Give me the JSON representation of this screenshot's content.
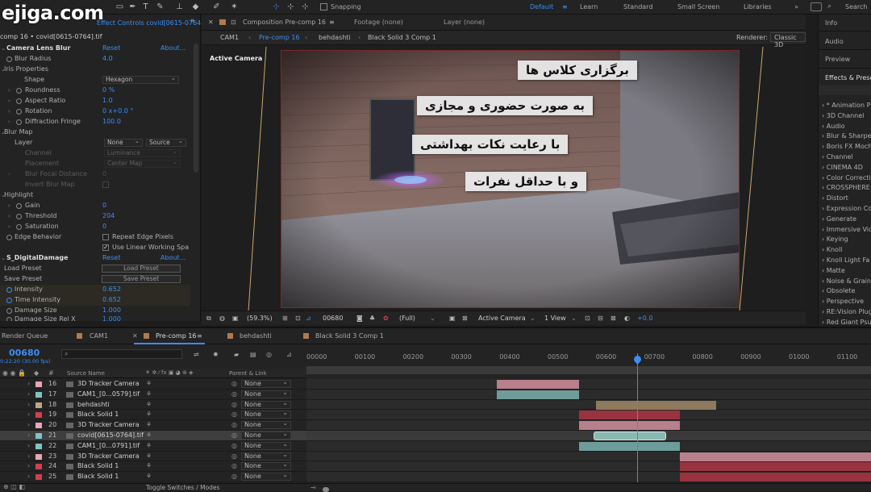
{
  "watermark": "ejiga.com",
  "toolbar": {
    "snapping_label": "Snapping",
    "workspaces": [
      "Default",
      "Learn",
      "Standard",
      "Small Screen",
      "Libraries"
    ],
    "active_workspace": "Default",
    "search_label": "Search"
  },
  "effects_panel": {
    "header": "Effect Controls covid[0615-0764].tif",
    "subtitle": "comp 16 • covid[0615-0764].tif",
    "reset": "Reset",
    "about": "About...",
    "rows": {
      "camera_lens_blur": "Camera Lens Blur",
      "blur_radius": "Blur Radius",
      "blur_radius_val": "4.0",
      "iris_properties": "Iris Properties",
      "shape": "Shape",
      "shape_val": "Hexagon",
      "roundness": "Roundness",
      "roundness_val": "0 %",
      "aspect_ratio": "Aspect Ratio",
      "aspect_ratio_val": "1.0",
      "rotation": "Rotation",
      "rotation_val": "0 x+0.0 °",
      "diffraction_fringe": "Diffraction Fringe",
      "diffraction_fringe_val": "100.0",
      "blur_map": "Blur Map",
      "layer": "Layer",
      "layer_val": "None",
      "layer_source": "Source",
      "channel": "Channel",
      "channel_val": "Luminance",
      "placement": "Placement",
      "placement_val": "Center Map",
      "blur_focal_distance": "Blur Focal Distance",
      "blur_focal_distance_val": "0",
      "invert_blur_map": "Invert Blur Map",
      "highlight": "Highlight",
      "gain": "Gain",
      "gain_val": "0",
      "threshold": "Threshold",
      "threshold_val": "204",
      "saturation": "Saturation",
      "saturation_val": "0",
      "edge_behavior": "Edge Behavior",
      "repeat_edge_pixels": "Repeat Edge Pixels",
      "use_linear": "Use Linear Working Spa",
      "s_digital_damage": "S_DigitalDamage",
      "load_preset": "Load Preset",
      "load_preset_btn": "Load Preset",
      "save_preset": "Save Preset",
      "save_preset_btn": "Save Preset",
      "intensity": "Intensity",
      "intensity_val": "0.652",
      "time_intensity": "Time Intensity",
      "time_intensity_val": "0.652",
      "damage_size": "Damage Size",
      "damage_size_val": "1.000",
      "damage_size_rel_x": "Damage Size Rel X",
      "damage_size_rel_x_val": "1.000"
    }
  },
  "composition": {
    "tab_label": "Composition Pre-comp 16",
    "footage_tab": "Footage (none)",
    "layer_tab": "Layer (none)",
    "breadcrumbs": [
      "CAM1",
      "Pre-comp 16",
      "behdashti",
      "Black Solid 3 Comp 1"
    ],
    "renderer_label": "Renderer:",
    "renderer_val": "Classic 3D",
    "active_camera_label": "Active Camera",
    "captions": [
      "برگزاری کلاس ها",
      "به صورت حضوری و مجازی",
      "با رعایت نکات بهداشتی",
      "و با حداقل نفرات"
    ],
    "zoom": "(59.3%)",
    "timecode": "00680",
    "resolution": "(Full)",
    "view_camera": "Active Camera",
    "view_count": "1 View",
    "exposure": "+0.0"
  },
  "right_panel": {
    "info": "Info",
    "audio": "Audio",
    "preview": "Preview",
    "effects_presets": "Effects & Presets",
    "categories": [
      "* Animation P",
      "3D Channel",
      "Audio",
      "Blur & Sharpe",
      "Boris FX Moch",
      "Channel",
      "CINEMA 4D",
      "Color Correcti",
      "CROSSPHERE",
      "Distort",
      "Expression Co",
      "Generate",
      "Immersive Vid",
      "Keying",
      "Knoll",
      "Knoll Light Fa",
      "Matte",
      "Noise & Grain",
      "Obsolete",
      "Perspective",
      "RE:Vision Plug",
      "Red Giant Psu"
    ]
  },
  "timeline": {
    "tabs": [
      "Render Queue",
      "CAM1",
      "Pre-comp 16",
      "behdashti",
      "Black Solid 3 Comp 1"
    ],
    "active_tab": "Pre-comp 16",
    "current_time": "00680",
    "time_sub": "0:22:20 (30.00 fps)",
    "col_source": "Source Name",
    "col_parent": "Parent & Link",
    "toggle_label": "Toggle Switches / Modes",
    "ruler": [
      "00000",
      "00100",
      "00200",
      "00300",
      "00400",
      "00500",
      "00600",
      "00700",
      "00800",
      "00900",
      "01000",
      "01100"
    ],
    "playhead_frame": 680,
    "layers": [
      {
        "num": "16",
        "name": "3D Tracker Camera",
        "color": "#e8a6b8",
        "parent": "None",
        "start": 390,
        "end": 560,
        "bar": "#b87f8c"
      },
      {
        "num": "17",
        "name": "CAM1_[0...0579].tif",
        "color": "#7fc4c4",
        "parent": "None",
        "start": 390,
        "end": 560,
        "bar": "#6e9c9a"
      },
      {
        "num": "18",
        "name": "behdashti",
        "color": "#bfa682",
        "parent": "None",
        "start": 595,
        "end": 845,
        "bar": "#8e7a5c"
      },
      {
        "num": "19",
        "name": "Black Solid 1",
        "color": "#d04050",
        "parent": "None",
        "start": 560,
        "end": 770,
        "bar": "#9a3340"
      },
      {
        "num": "20",
        "name": "3D Tracker Camera",
        "color": "#e8a6b8",
        "parent": "None",
        "start": 560,
        "end": 770,
        "bar": "#b87f8c"
      },
      {
        "num": "21",
        "name": "covid[0615-0764].tif",
        "color": "#7fc4c4",
        "parent": "None",
        "start": 590,
        "end": 740,
        "bar": "#8ab8b2"
      },
      {
        "num": "22",
        "name": "CAM1_[0...0791].tif",
        "color": "#7fc4c4",
        "parent": "None",
        "start": 560,
        "end": 770,
        "bar": "#6e9c9a"
      },
      {
        "num": "23",
        "name": "3D Tracker Camera",
        "color": "#e8a6b8",
        "parent": "None",
        "start": 770,
        "end": 1170,
        "bar": "#b87f8c"
      },
      {
        "num": "24",
        "name": "Black Solid 1",
        "color": "#d04050",
        "parent": "None",
        "start": 770,
        "end": 1170,
        "bar": "#9a3340"
      },
      {
        "num": "25",
        "name": "Black Solid 1",
        "color": "#d04050",
        "parent": "None",
        "start": 770,
        "end": 1170,
        "bar": "#9a3340"
      }
    ]
  }
}
